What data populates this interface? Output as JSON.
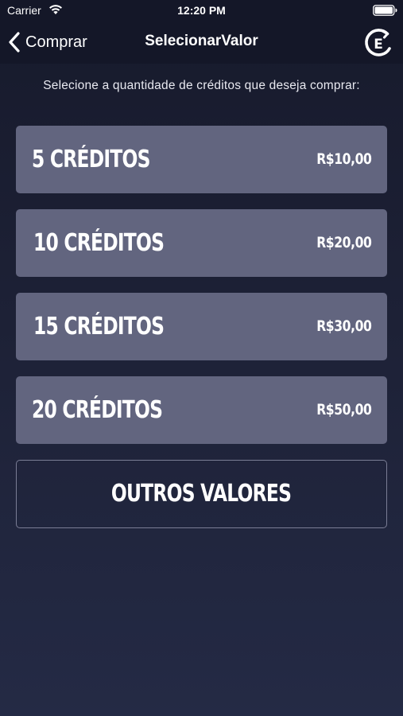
{
  "status_bar": {
    "carrier": "Carrier",
    "time": "12:20 PM",
    "wifi_icon": "wifi-icon",
    "battery_icon": "battery-icon"
  },
  "nav": {
    "back_label": "Comprar",
    "back_icon": "chevron-left-icon",
    "title": "SelecionarValor",
    "logo_icon": "e-logo-icon"
  },
  "instruction": "Selecione a quantidade de créditos que deseja comprar:",
  "options": [
    {
      "label": "5 CRÉDITOS",
      "price": "R$10,00"
    },
    {
      "label": "10 CRÉDITOS",
      "price": "R$20,00"
    },
    {
      "label": "15 CRÉDITOS",
      "price": "R$30,00"
    },
    {
      "label": "20 CRÉDITOS",
      "price": "R$50,00"
    }
  ],
  "other_button_label": "OUTROS VALORES",
  "colors": {
    "background": "#1c1f33",
    "option_fill": "#62657f",
    "text": "#ffffff"
  }
}
